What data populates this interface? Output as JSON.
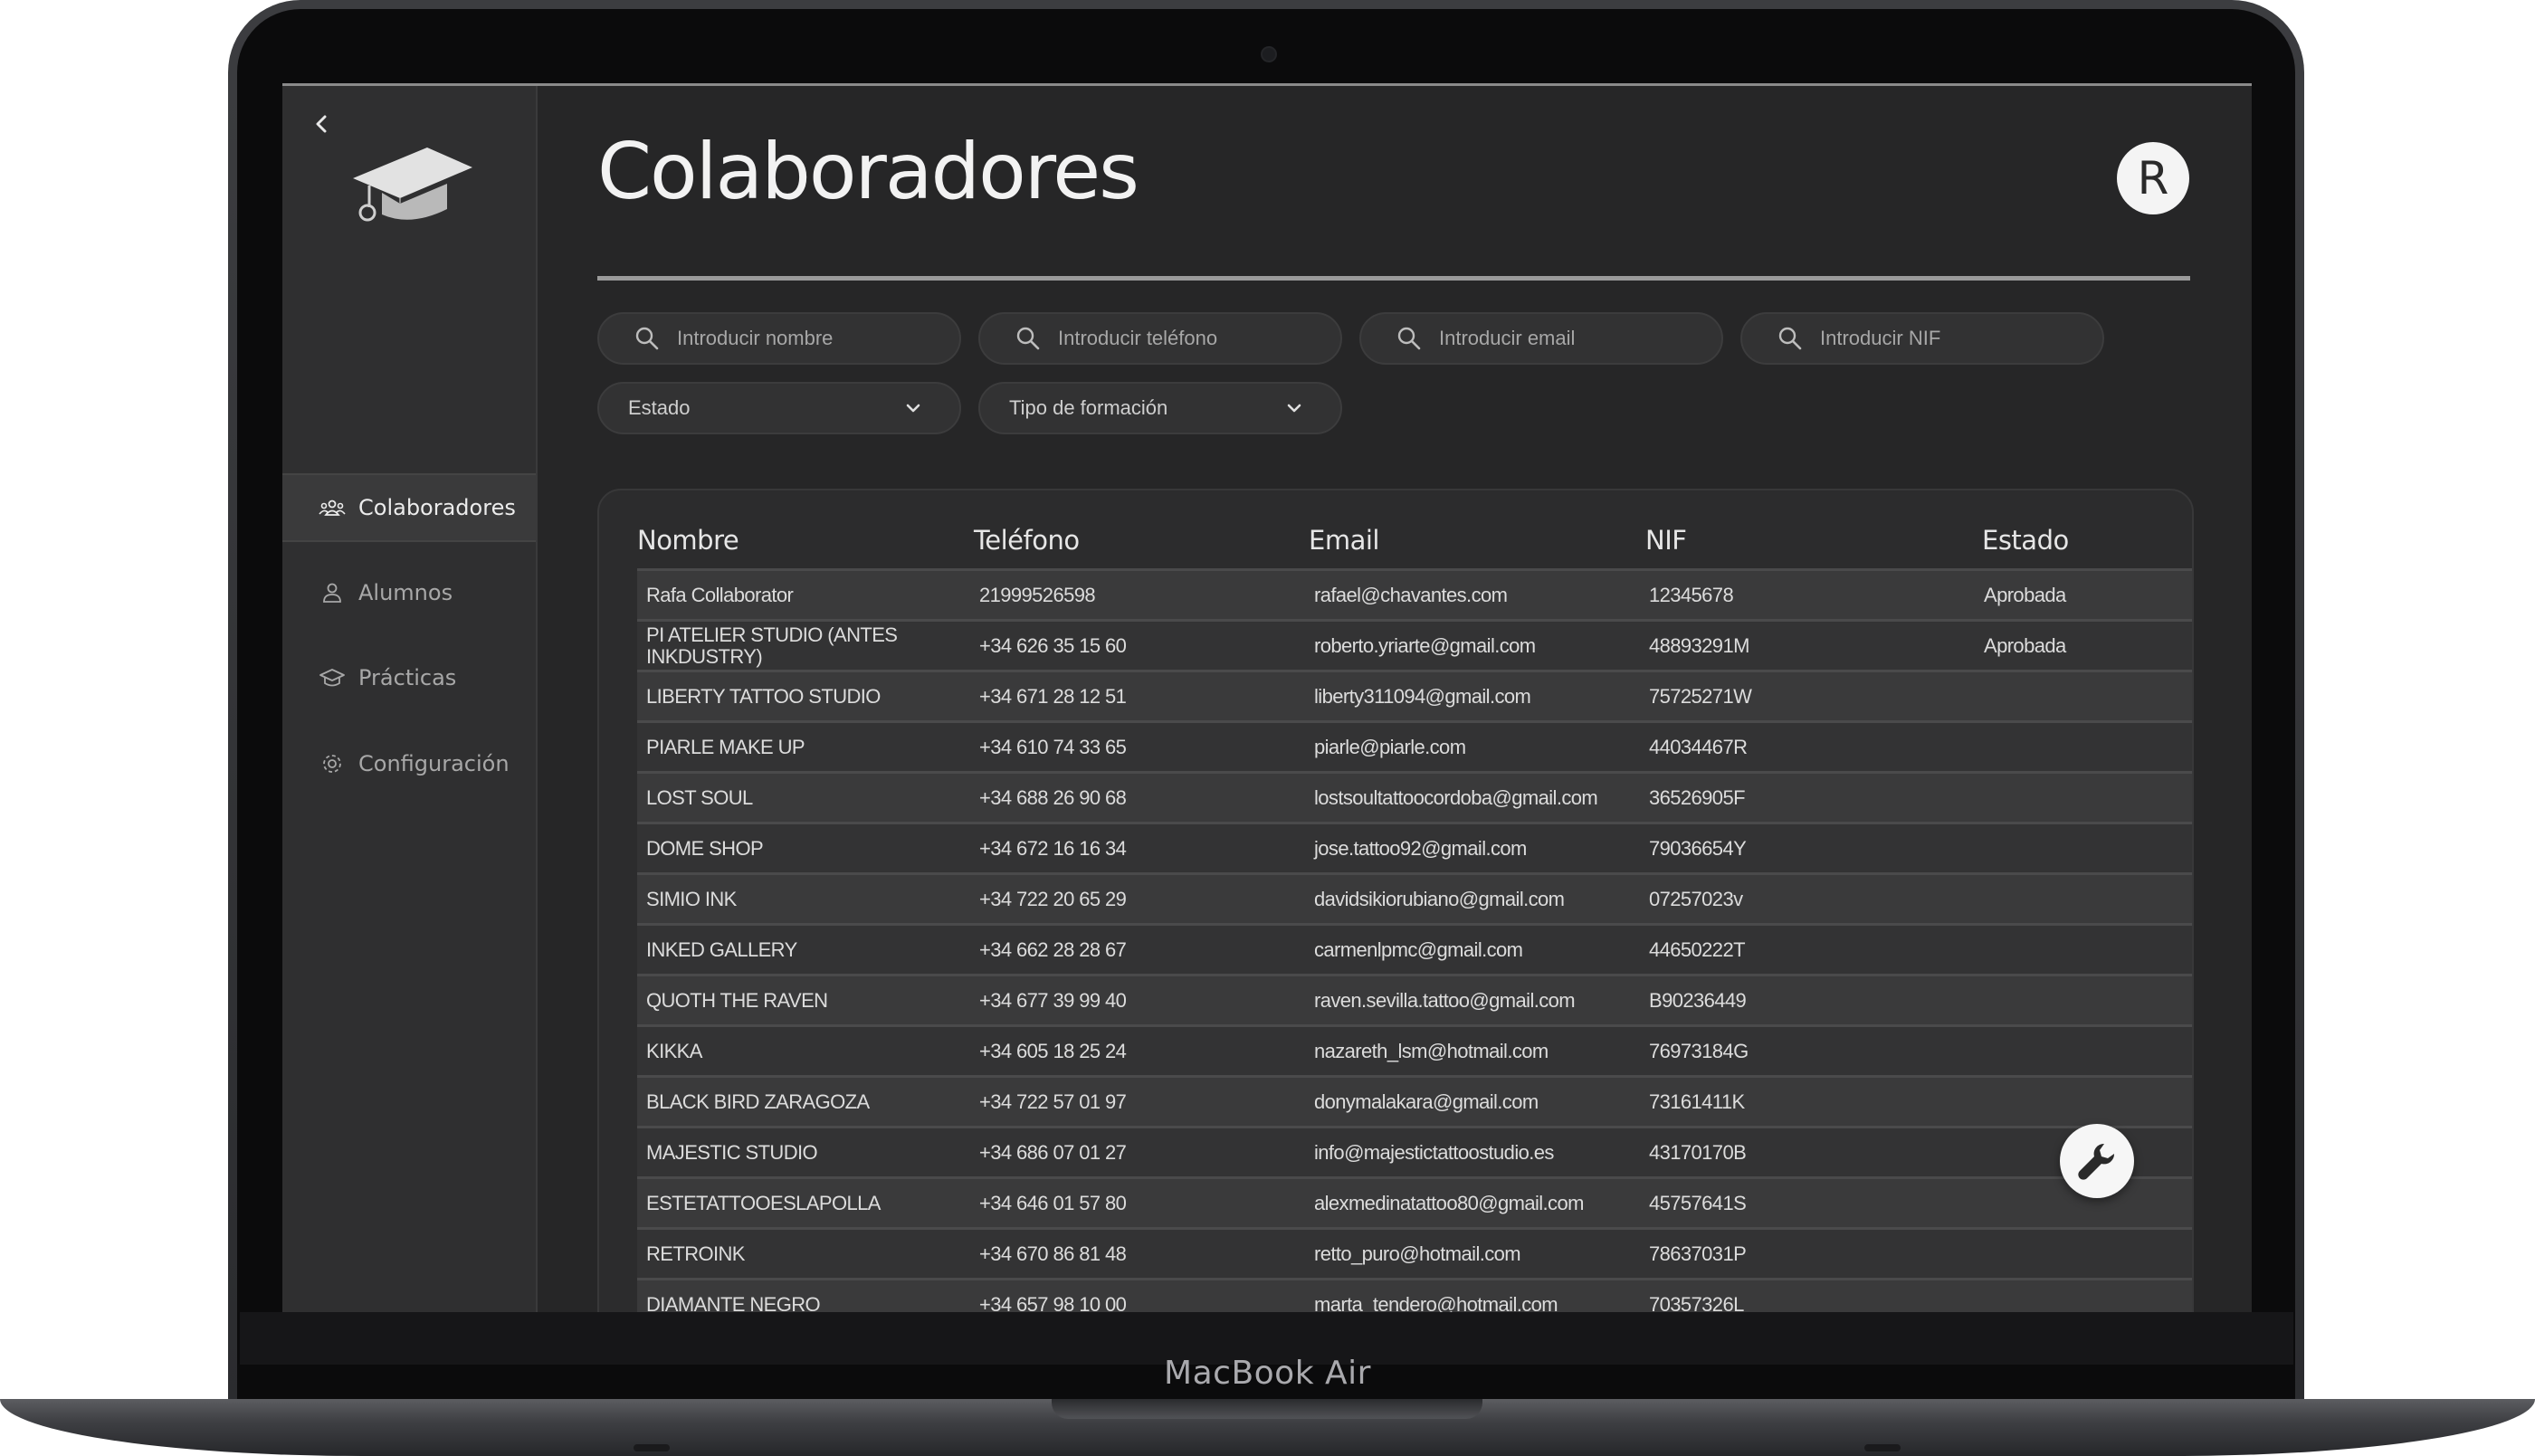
{
  "device": {
    "label": "MacBook Air"
  },
  "sidebar": {
    "items": [
      {
        "label": "Colaboradores",
        "icon": "users-icon",
        "active": true
      },
      {
        "label": "Alumnos",
        "icon": "user-icon",
        "active": false
      },
      {
        "label": "Prácticas",
        "icon": "graduation-cap-icon",
        "active": false
      },
      {
        "label": "Configuración",
        "icon": "gear-icon",
        "active": false
      }
    ]
  },
  "header": {
    "title": "Colaboradores",
    "avatar_initial": "R"
  },
  "filters": {
    "name_placeholder": "Introducir nombre",
    "phone_placeholder": "Introducir teléfono",
    "email_placeholder": "Introducir email",
    "nif_placeholder": "Introducir NIF",
    "status_select": "Estado",
    "training_select": "Tipo de formación"
  },
  "table": {
    "headers": [
      "Nombre",
      "Teléfono",
      "Email",
      "NIF",
      "Estado"
    ],
    "rows": [
      [
        "Rafa Collaborator",
        "21999526598",
        "rafael@chavantes.com",
        "12345678",
        "Aprobada"
      ],
      [
        "PI ATELIER STUDIO (ANTES INKDUSTRY)",
        "+34 626 35 15 60",
        "roberto.yriarte@gmail.com",
        "48893291M",
        "Aprobada"
      ],
      [
        "LIBERTY TATTOO STUDIO",
        "+34 671 28 12 51",
        "liberty311094@gmail.com",
        "75725271W",
        ""
      ],
      [
        "PIARLE MAKE UP",
        "+34 610 74 33 65",
        "piarle@piarle.com",
        "44034467R",
        ""
      ],
      [
        "LOST SOUL",
        "+34 688 26 90 68",
        "lostsoultattoocordoba@gmail.com",
        "36526905F",
        ""
      ],
      [
        "DOME SHOP",
        "+34 672 16 16 34",
        "jose.tattoo92@gmail.com",
        "79036654Y",
        ""
      ],
      [
        "SIMIO INK",
        "+34 722 20 65 29",
        "davidsikiorubiano@gmail.com",
        "07257023v",
        ""
      ],
      [
        "INKED GALLERY",
        "+34 662 28 28 67",
        "carmenlpmc@gmail.com",
        "44650222T",
        ""
      ],
      [
        "QUOTH THE RAVEN",
        "+34 677 39 99 40",
        "raven.sevilla.tattoo@gmail.com",
        "B90236449",
        ""
      ],
      [
        "KIKKA",
        "+34 605 18 25 24",
        "nazareth_lsm@hotmail.com",
        "76973184G",
        ""
      ],
      [
        "BLACK BIRD ZARAGOZA",
        "+34 722 57 01 97",
        "donymalakara@gmail.com",
        "73161411K",
        ""
      ],
      [
        "MAJESTIC STUDIO",
        "+34 686 07 01 27",
        "info@majestictattoostudio.es",
        "43170170B",
        ""
      ],
      [
        "ESTETATTOOESLAPOLLA",
        "+34 646 01 57 80",
        "alexmedinatattoo80@gmail.com",
        "45757641S",
        ""
      ],
      [
        "RETROINK",
        "+34 670 86 81 48",
        "retto_puro@hotmail.com",
        "78637031P",
        ""
      ],
      [
        "DIAMANTE NEGRO",
        "+34 657 98 10 00",
        "marta_tendero@hotmail.com",
        "70357326L",
        ""
      ]
    ]
  },
  "colors": {
    "background": "#262627",
    "sidebar": "#2f2f30",
    "text": "#f2f2f2",
    "accent": "#f4f4f4"
  }
}
